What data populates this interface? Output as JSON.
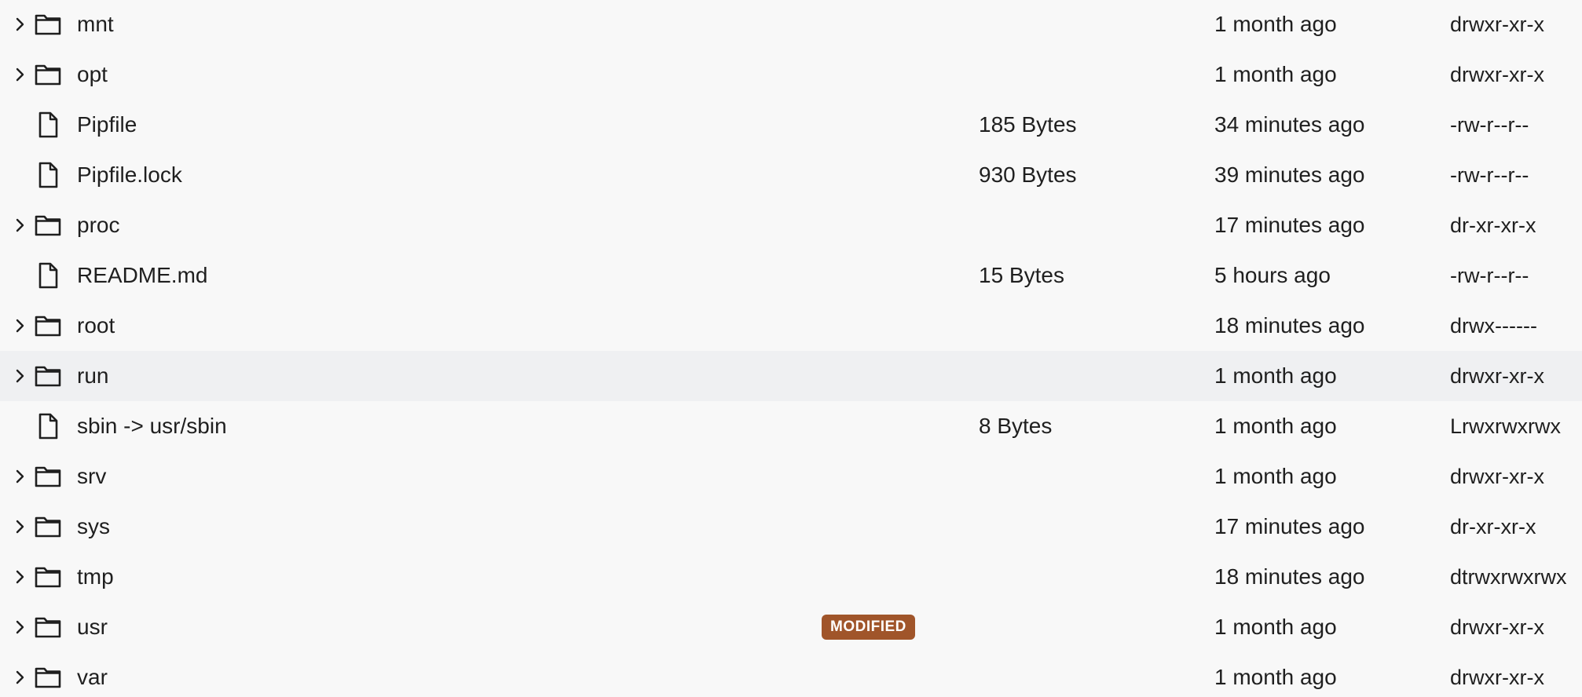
{
  "file_list": {
    "rows": [
      {
        "name": "mnt",
        "kind": "folder",
        "size": "",
        "modified": "1 month ago",
        "permissions": "drwxr-xr-x",
        "badge": ""
      },
      {
        "name": "opt",
        "kind": "folder",
        "size": "",
        "modified": "1 month ago",
        "permissions": "drwxr-xr-x",
        "badge": ""
      },
      {
        "name": "Pipfile",
        "kind": "file",
        "size": "185 Bytes",
        "modified": "34 minutes ago",
        "permissions": "-rw-r--r--",
        "badge": ""
      },
      {
        "name": "Pipfile.lock",
        "kind": "file",
        "size": "930 Bytes",
        "modified": "39 minutes ago",
        "permissions": "-rw-r--r--",
        "badge": ""
      },
      {
        "name": "proc",
        "kind": "folder",
        "size": "",
        "modified": "17 minutes ago",
        "permissions": "dr-xr-xr-x",
        "badge": ""
      },
      {
        "name": "README.md",
        "kind": "file",
        "size": "15 Bytes",
        "modified": "5 hours ago",
        "permissions": "-rw-r--r--",
        "badge": ""
      },
      {
        "name": "root",
        "kind": "folder",
        "size": "",
        "modified": "18 minutes ago",
        "permissions": "drwx------",
        "badge": ""
      },
      {
        "name": "run",
        "kind": "folder",
        "size": "",
        "modified": "1 month ago",
        "permissions": "drwxr-xr-x",
        "badge": "",
        "highlighted": true
      },
      {
        "name": "sbin -> usr/sbin",
        "kind": "file",
        "size": "8 Bytes",
        "modified": "1 month ago",
        "permissions": "Lrwxrwxrwx",
        "badge": ""
      },
      {
        "name": "srv",
        "kind": "folder",
        "size": "",
        "modified": "1 month ago",
        "permissions": "drwxr-xr-x",
        "badge": ""
      },
      {
        "name": "sys",
        "kind": "folder",
        "size": "",
        "modified": "17 minutes ago",
        "permissions": "dr-xr-xr-x",
        "badge": ""
      },
      {
        "name": "tmp",
        "kind": "folder",
        "size": "",
        "modified": "18 minutes ago",
        "permissions": "dtrwxrwxrwx",
        "badge": ""
      },
      {
        "name": "usr",
        "kind": "folder",
        "size": "",
        "modified": "1 month ago",
        "permissions": "drwxr-xr-x",
        "badge": "MODIFIED"
      },
      {
        "name": "var",
        "kind": "folder",
        "size": "",
        "modified": "1 month ago",
        "permissions": "drwxr-xr-x",
        "badge": ""
      }
    ]
  },
  "icons": {
    "expand": "chevron-right-icon",
    "folder": "folder-icon",
    "file": "file-icon"
  },
  "colors": {
    "background": "#f8f8f8",
    "highlight_row": "#eff0f2",
    "badge_background": "#a0552a",
    "badge_text": "#ffffff",
    "text": "#1f1f1f"
  }
}
